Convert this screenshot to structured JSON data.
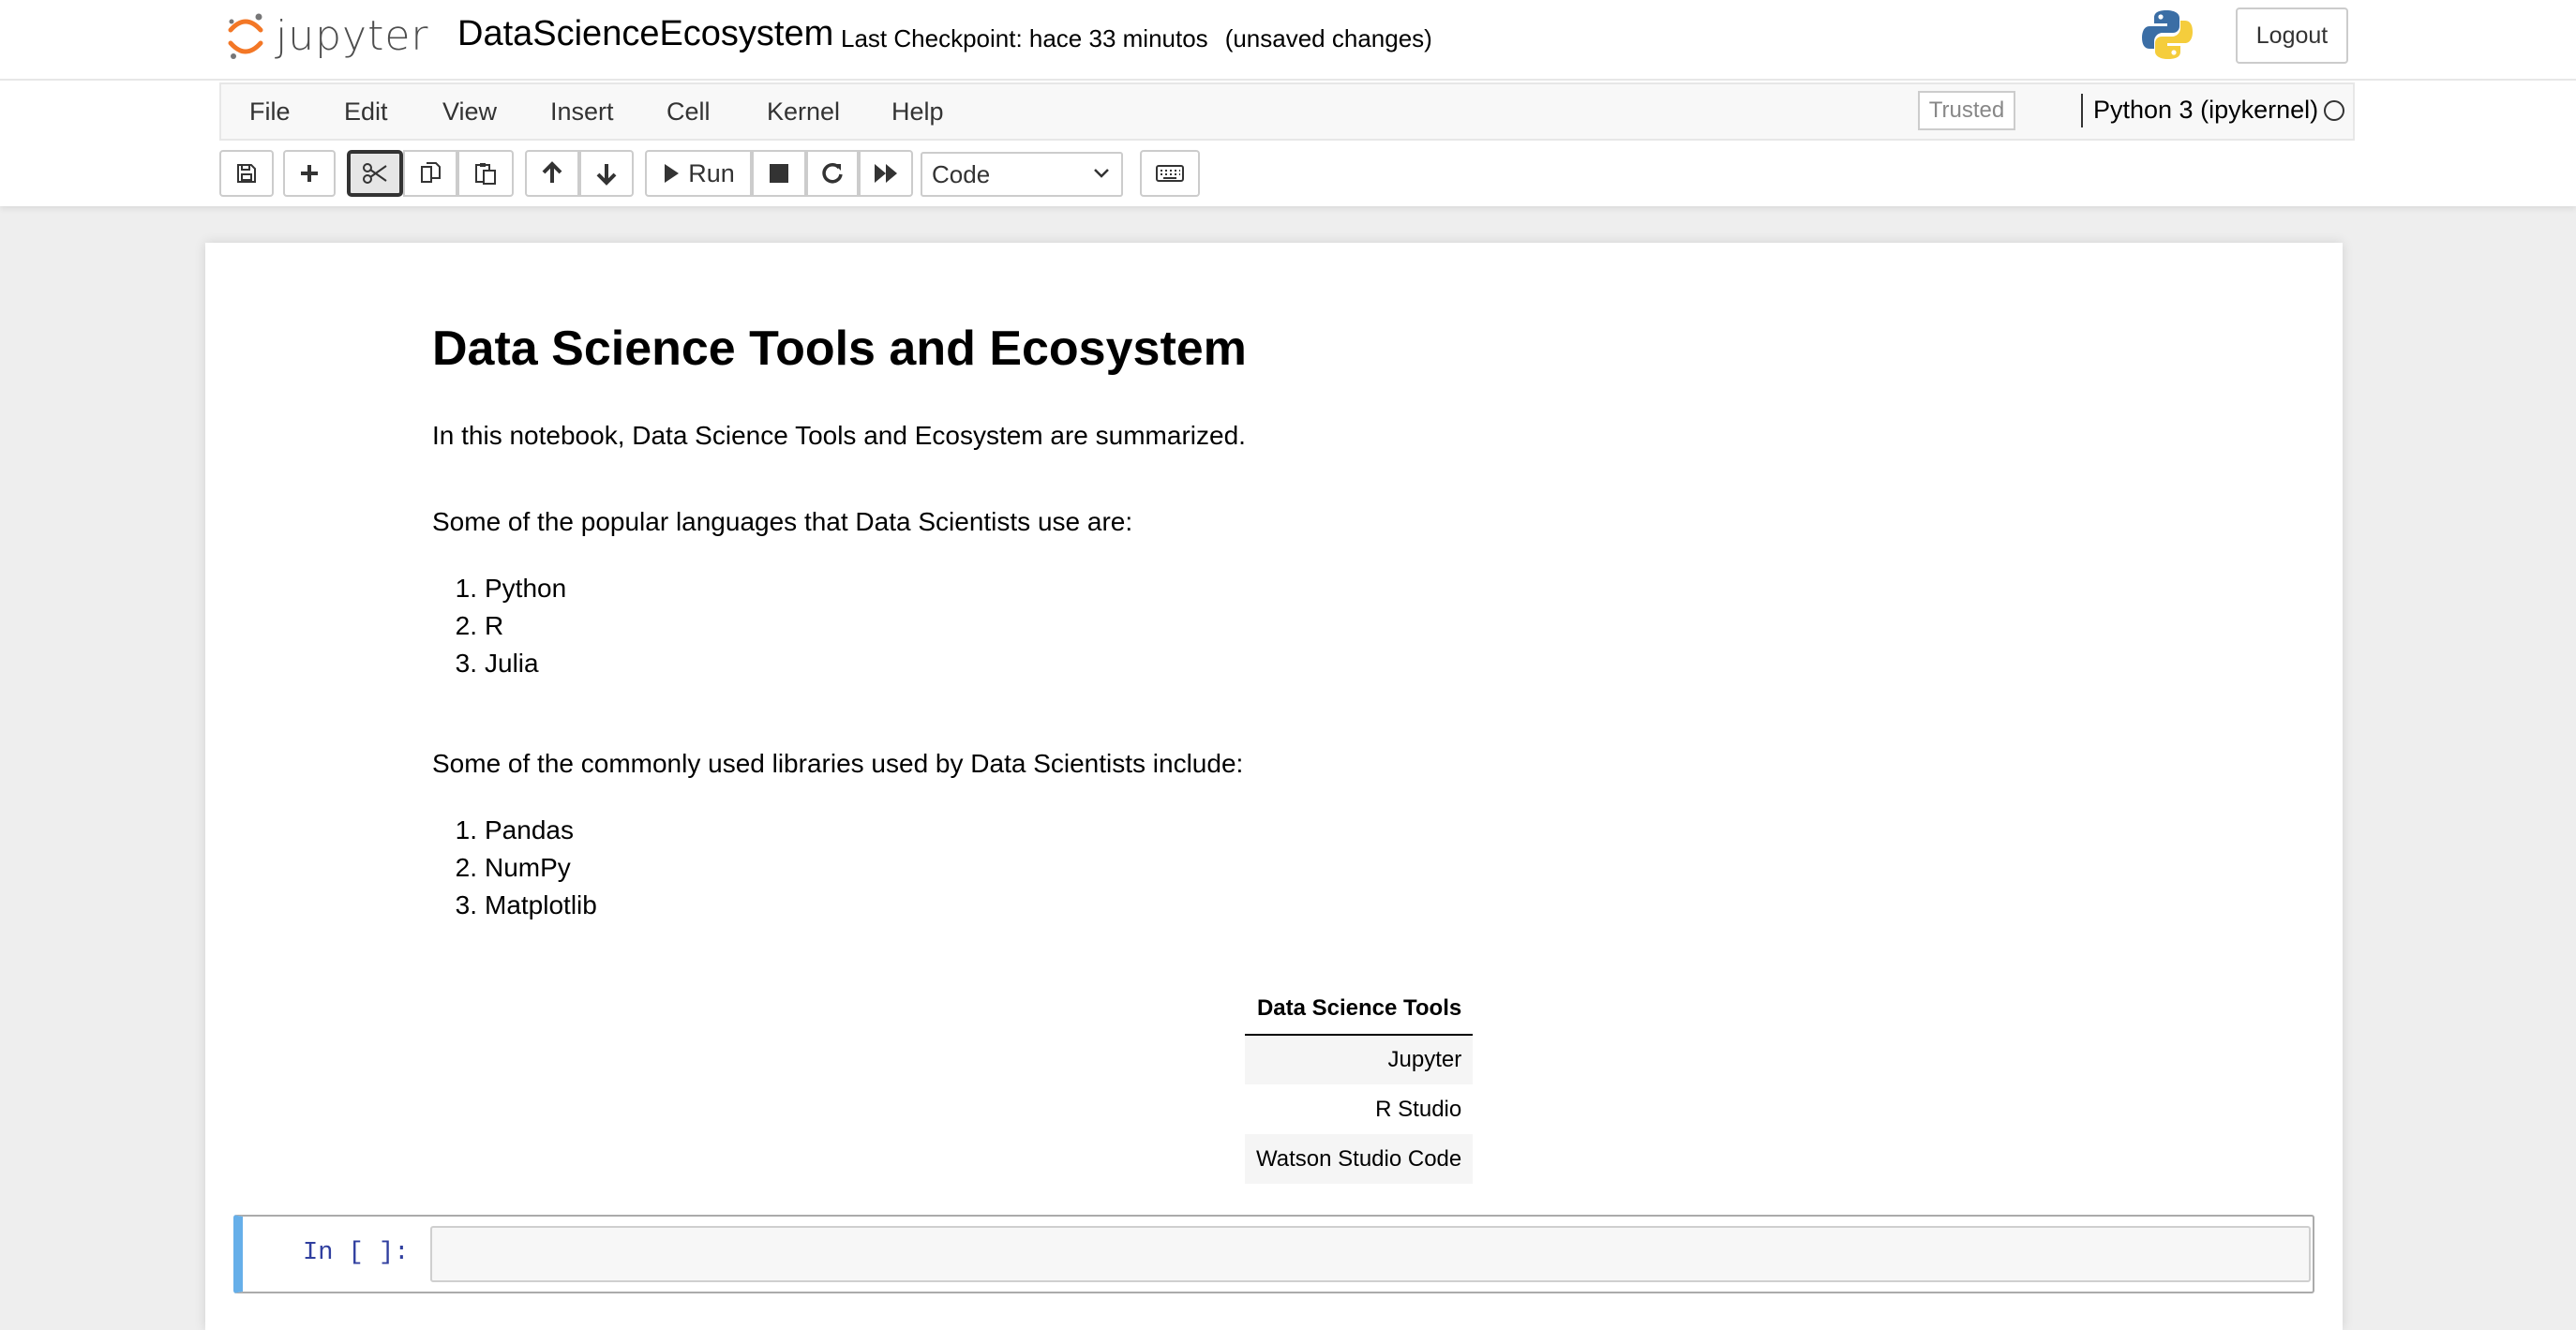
{
  "header": {
    "logo_text": "jupyter",
    "notebook_name": "DataScienceEcosystem",
    "checkpoint": "Last Checkpoint: hace 33 minutos",
    "unsaved": "(unsaved changes)",
    "logout_label": "Logout"
  },
  "menubar": {
    "items": [
      "File",
      "Edit",
      "View",
      "Insert",
      "Cell",
      "Kernel",
      "Help"
    ],
    "trusted": "Trusted",
    "kernel_name": "Python 3 (ipykernel)"
  },
  "toolbar": {
    "run_label": "Run",
    "cell_type": "Code",
    "buttons": [
      "save-icon",
      "plus-icon",
      "scissors-icon",
      "copy-icon",
      "paste-icon",
      "arrow-up-icon",
      "arrow-down-icon",
      "play-icon",
      "stop-icon",
      "restart-icon",
      "fast-forward-icon",
      "keyboard-icon"
    ]
  },
  "notebook": {
    "title": "Data Science Tools and Ecosystem",
    "intro": "In this notebook, Data Science Tools and Ecosystem are summarized.",
    "languages_intro": "Some of the popular languages that Data Scientists use are:",
    "languages": [
      "Python",
      "R",
      "Julia"
    ],
    "libraries_intro": "Some of the commonly used libraries used by Data Scientists include:",
    "libraries": [
      "Pandas",
      "NumPy",
      "Matplotlib"
    ],
    "table": {
      "header": "Data Science Tools",
      "rows": [
        "Jupyter",
        "R Studio",
        "Watson Studio Code"
      ]
    },
    "code_prompt": "In [ ]:"
  },
  "colors": {
    "accent_selected_cell": "#66afe9",
    "prompt": "#303f9f",
    "jupyter_orange": "#f37726"
  }
}
